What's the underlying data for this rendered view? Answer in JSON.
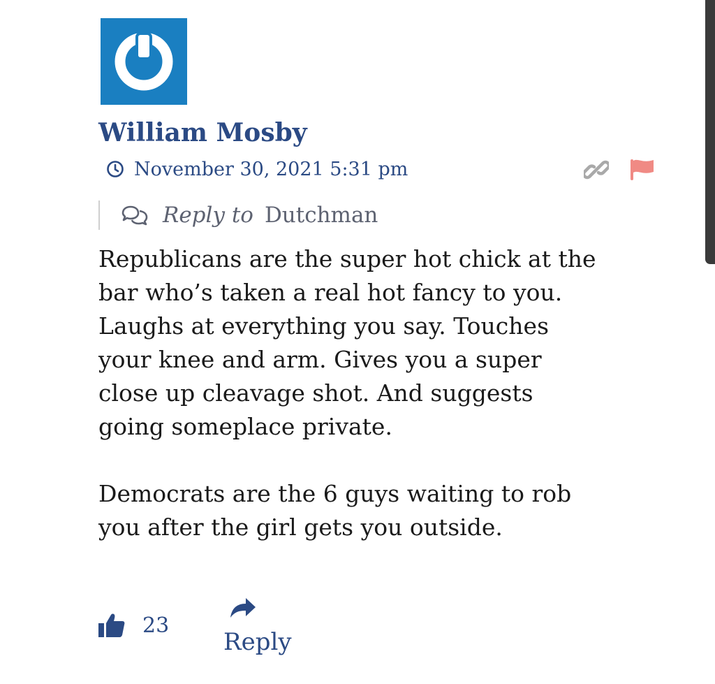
{
  "comment": {
    "author": "William Mosby",
    "timestamp": "November 30, 2021 5:31 pm",
    "reply_to_label": "Reply to",
    "reply_to_target": "Dutchman",
    "body_paragraphs": [
      [
        "Republicans are the super hot chick at the",
        "bar who’s taken a real hot fancy to you.",
        "Laughs at everything you say. Touches",
        "your knee and arm. Gives you a super",
        "close up cleavage shot. And suggests",
        "going someplace private."
      ],
      [
        "Democrats are the 6 guys waiting to rob",
        "you after the girl gets you outside."
      ]
    ],
    "likes": "23",
    "reply_label": "Reply"
  },
  "icons": {
    "avatar": "power-symbol-icon",
    "time": "clock-icon",
    "link": "link-icon",
    "flag": "flag-icon",
    "reply_to": "chat-bubbles-icon",
    "like": "thumbs-up-icon",
    "reply": "reply-arrow-icon"
  },
  "colors": {
    "author": "#2b4a84",
    "avatar_bg": "#1a7fc1",
    "flag": "#f08a84",
    "link": "#a9a9a9",
    "body_text": "#1a1a1a",
    "muted": "#5d6271"
  }
}
